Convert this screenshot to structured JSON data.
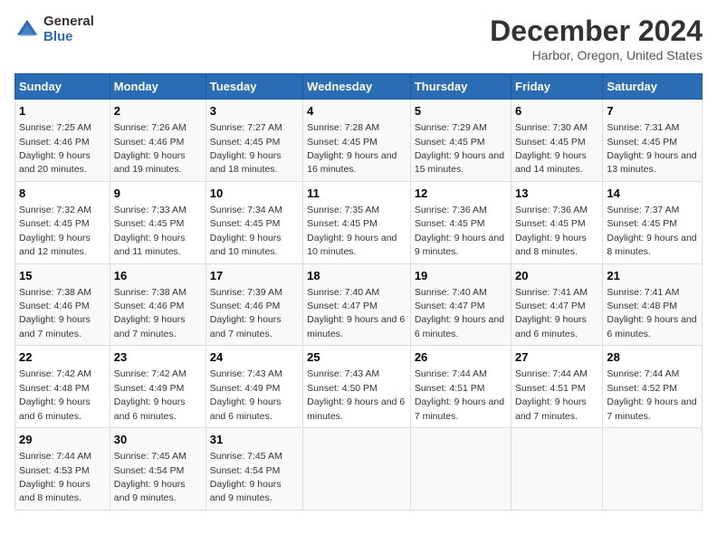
{
  "header": {
    "logo_general": "General",
    "logo_blue": "Blue",
    "title": "December 2024",
    "subtitle": "Harbor, Oregon, United States"
  },
  "days_of_week": [
    "Sunday",
    "Monday",
    "Tuesday",
    "Wednesday",
    "Thursday",
    "Friday",
    "Saturday"
  ],
  "weeks": [
    [
      {
        "day": "1",
        "sunrise": "7:25 AM",
        "sunset": "4:46 PM",
        "daylight": "9 hours and 20 minutes."
      },
      {
        "day": "2",
        "sunrise": "7:26 AM",
        "sunset": "4:46 PM",
        "daylight": "9 hours and 19 minutes."
      },
      {
        "day": "3",
        "sunrise": "7:27 AM",
        "sunset": "4:45 PM",
        "daylight": "9 hours and 18 minutes."
      },
      {
        "day": "4",
        "sunrise": "7:28 AM",
        "sunset": "4:45 PM",
        "daylight": "9 hours and 16 minutes."
      },
      {
        "day": "5",
        "sunrise": "7:29 AM",
        "sunset": "4:45 PM",
        "daylight": "9 hours and 15 minutes."
      },
      {
        "day": "6",
        "sunrise": "7:30 AM",
        "sunset": "4:45 PM",
        "daylight": "9 hours and 14 minutes."
      },
      {
        "day": "7",
        "sunrise": "7:31 AM",
        "sunset": "4:45 PM",
        "daylight": "9 hours and 13 minutes."
      }
    ],
    [
      {
        "day": "8",
        "sunrise": "7:32 AM",
        "sunset": "4:45 PM",
        "daylight": "9 hours and 12 minutes."
      },
      {
        "day": "9",
        "sunrise": "7:33 AM",
        "sunset": "4:45 PM",
        "daylight": "9 hours and 11 minutes."
      },
      {
        "day": "10",
        "sunrise": "7:34 AM",
        "sunset": "4:45 PM",
        "daylight": "9 hours and 10 minutes."
      },
      {
        "day": "11",
        "sunrise": "7:35 AM",
        "sunset": "4:45 PM",
        "daylight": "9 hours and 10 minutes."
      },
      {
        "day": "12",
        "sunrise": "7:36 AM",
        "sunset": "4:45 PM",
        "daylight": "9 hours and 9 minutes."
      },
      {
        "day": "13",
        "sunrise": "7:36 AM",
        "sunset": "4:45 PM",
        "daylight": "9 hours and 8 minutes."
      },
      {
        "day": "14",
        "sunrise": "7:37 AM",
        "sunset": "4:45 PM",
        "daylight": "9 hours and 8 minutes."
      }
    ],
    [
      {
        "day": "15",
        "sunrise": "7:38 AM",
        "sunset": "4:46 PM",
        "daylight": "9 hours and 7 minutes."
      },
      {
        "day": "16",
        "sunrise": "7:38 AM",
        "sunset": "4:46 PM",
        "daylight": "9 hours and 7 minutes."
      },
      {
        "day": "17",
        "sunrise": "7:39 AM",
        "sunset": "4:46 PM",
        "daylight": "9 hours and 7 minutes."
      },
      {
        "day": "18",
        "sunrise": "7:40 AM",
        "sunset": "4:47 PM",
        "daylight": "9 hours and 6 minutes."
      },
      {
        "day": "19",
        "sunrise": "7:40 AM",
        "sunset": "4:47 PM",
        "daylight": "9 hours and 6 minutes."
      },
      {
        "day": "20",
        "sunrise": "7:41 AM",
        "sunset": "4:47 PM",
        "daylight": "9 hours and 6 minutes."
      },
      {
        "day": "21",
        "sunrise": "7:41 AM",
        "sunset": "4:48 PM",
        "daylight": "9 hours and 6 minutes."
      }
    ],
    [
      {
        "day": "22",
        "sunrise": "7:42 AM",
        "sunset": "4:48 PM",
        "daylight": "9 hours and 6 minutes."
      },
      {
        "day": "23",
        "sunrise": "7:42 AM",
        "sunset": "4:49 PM",
        "daylight": "9 hours and 6 minutes."
      },
      {
        "day": "24",
        "sunrise": "7:43 AM",
        "sunset": "4:49 PM",
        "daylight": "9 hours and 6 minutes."
      },
      {
        "day": "25",
        "sunrise": "7:43 AM",
        "sunset": "4:50 PM",
        "daylight": "9 hours and 6 minutes."
      },
      {
        "day": "26",
        "sunrise": "7:44 AM",
        "sunset": "4:51 PM",
        "daylight": "9 hours and 7 minutes."
      },
      {
        "day": "27",
        "sunrise": "7:44 AM",
        "sunset": "4:51 PM",
        "daylight": "9 hours and 7 minutes."
      },
      {
        "day": "28",
        "sunrise": "7:44 AM",
        "sunset": "4:52 PM",
        "daylight": "9 hours and 7 minutes."
      }
    ],
    [
      {
        "day": "29",
        "sunrise": "7:44 AM",
        "sunset": "4:53 PM",
        "daylight": "9 hours and 8 minutes."
      },
      {
        "day": "30",
        "sunrise": "7:45 AM",
        "sunset": "4:54 PM",
        "daylight": "9 hours and 9 minutes."
      },
      {
        "day": "31",
        "sunrise": "7:45 AM",
        "sunset": "4:54 PM",
        "daylight": "9 hours and 9 minutes."
      },
      null,
      null,
      null,
      null
    ]
  ],
  "labels": {
    "sunrise": "Sunrise:",
    "sunset": "Sunset:",
    "daylight": "Daylight:"
  }
}
